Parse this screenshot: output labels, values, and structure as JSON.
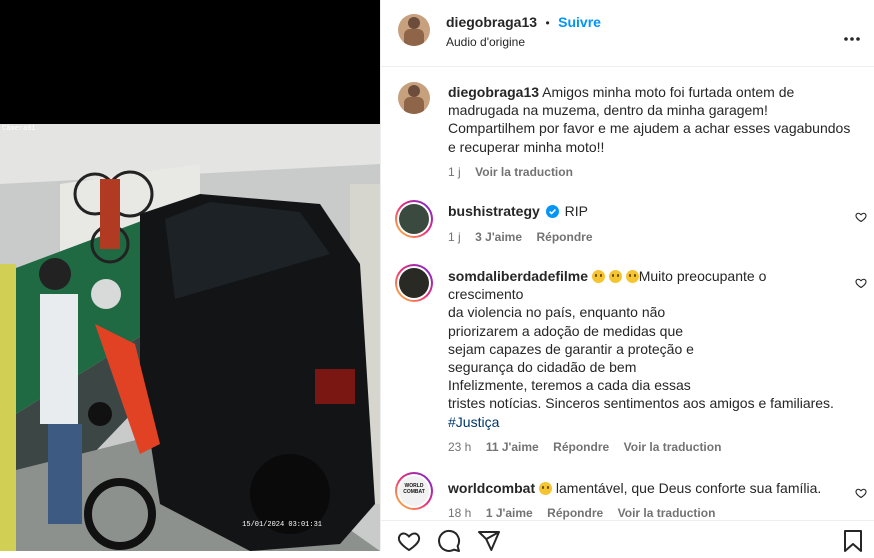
{
  "media": {
    "camera_label": "Câmera01",
    "timestamp": "15/01/2024 03:01:31"
  },
  "header": {
    "username": "diegobraga13",
    "separator": "•",
    "follow_label": "Suivre",
    "audio_label": "Audio d'origine",
    "more_icon": "more-horizontal-icon"
  },
  "caption": {
    "username": "diegobraga13",
    "text_lines": [
      "Amigos minha moto foi furtada ontem de",
      "madrugada na muzema, dentro da minha garagem!",
      "Compartilhem por favor e me ajudem a achar esses vagabundos",
      "e recuperar minha moto!!"
    ],
    "time": "1 j",
    "translate": "Voir la traduction"
  },
  "comments": [
    {
      "username": "bushistrategy",
      "verified": true,
      "text": "RIP",
      "time": "1 j",
      "likes": "3 J'aime",
      "reply": "Répondre"
    },
    {
      "username": "somdaliberdadefilme",
      "emoji_count": 3,
      "first_line": "Muito preocupante o",
      "lines": [
        "crescimento",
        "da violencia no país, enquanto não",
        "priorizarem a adoção de medidas que",
        "sejam capazes de garantir a proteção e",
        "segurança do cidadão de bem",
        "Infelizmente, teremos a cada dia essas",
        "tristes notícias. Sinceros sentimentos aos amigos e familiares."
      ],
      "hashtag": "#Justiça",
      "time": "23 h",
      "likes": "11 J'aime",
      "reply": "Répondre",
      "translate": "Voir la traduction"
    },
    {
      "username": "worldcombat",
      "avatar_text": "WORLD COMBAT",
      "text": "lamentável, que Deus conforte sua família.",
      "time": "18 h",
      "likes": "1 J'aime",
      "reply": "Répondre",
      "translate": "Voir la traduction"
    }
  ],
  "colors": {
    "link_blue": "#0095f6",
    "verified_blue": "#0095f6",
    "text": "#262626",
    "muted": "#737373"
  }
}
